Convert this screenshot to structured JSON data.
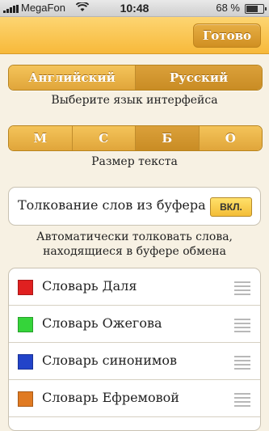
{
  "status_bar": {
    "carrier": "MegaFon",
    "time": "10:48",
    "battery_percent": "68 %",
    "battery_level": 0.68
  },
  "navbar": {
    "done_label": "Готово"
  },
  "language": {
    "options": [
      "Английский",
      "Русский"
    ],
    "selected_index": 1,
    "caption": "Выберите язык интерфейса"
  },
  "text_size": {
    "options": [
      "М",
      "С",
      "Б",
      "О"
    ],
    "selected_index": 2,
    "caption": "Размер текста"
  },
  "buffer": {
    "label": "Толкование слов из буфера",
    "toggle_label": "ВКЛ.",
    "caption_line1": "Автоматически толковать слова,",
    "caption_line2": "находящиеся в буфере обмена"
  },
  "dictionaries": [
    {
      "name": "Словарь Даля",
      "color": "#e02020"
    },
    {
      "name": "Словарь Ожегова",
      "color": "#35d43a"
    },
    {
      "name": "Словарь синонимов",
      "color": "#2243c9"
    },
    {
      "name": "Словарь Ефремовой",
      "color": "#e07a22"
    }
  ]
}
